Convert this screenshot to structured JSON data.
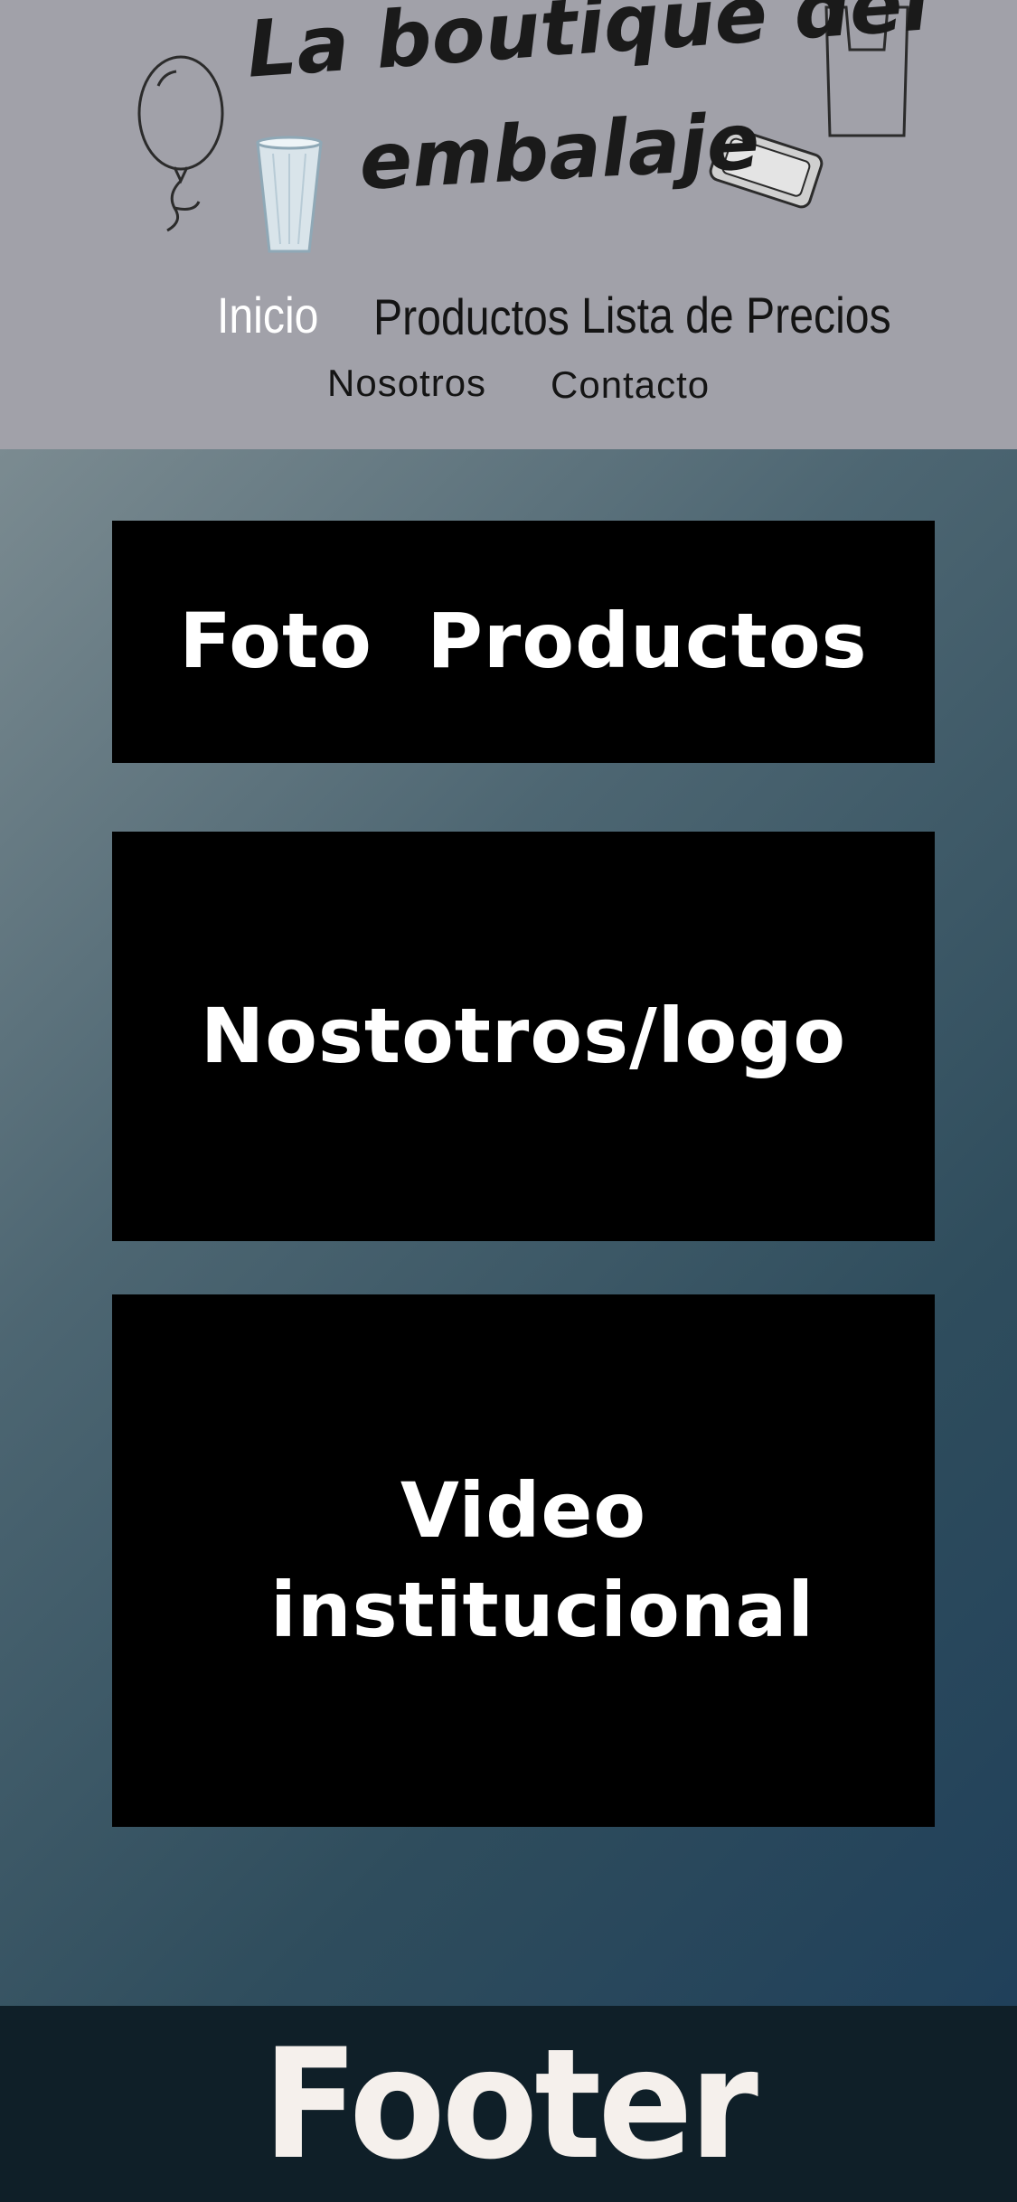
{
  "header": {
    "logo_text_line1": "La boutique del",
    "logo_text_line2": "embalaje",
    "background": "#a1a1a9"
  },
  "nav": {
    "items": [
      {
        "label": "Inicio",
        "active": true
      },
      {
        "label": "Productos",
        "active": false
      },
      {
        "label": "Lista de Precios",
        "active": false
      },
      {
        "label": "Nosotros",
        "active": false
      },
      {
        "label": "Contacto",
        "active": false
      }
    ]
  },
  "main": {
    "blocks": [
      {
        "label": "Foto  Productos"
      },
      {
        "label": "Nostotros/logo"
      },
      {
        "label": "Video institucional"
      }
    ]
  },
  "footer": {
    "label": "Footer",
    "background": "#0f1f28"
  }
}
